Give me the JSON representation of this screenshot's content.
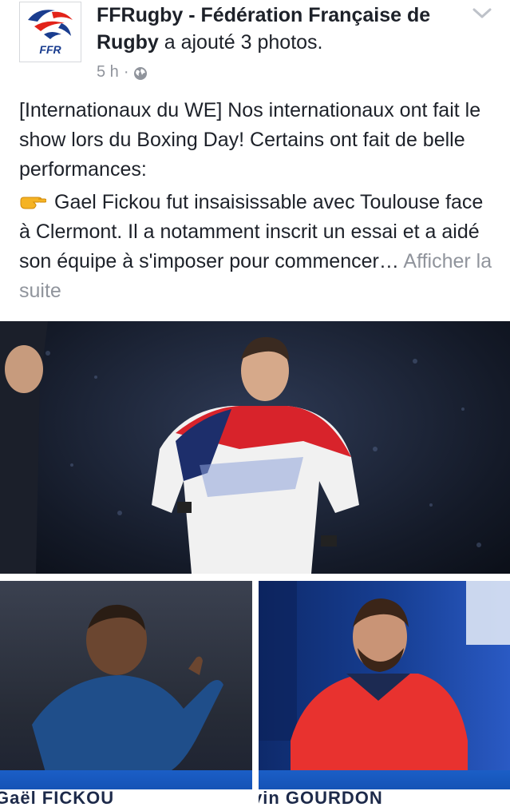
{
  "post": {
    "page_name": "FFRugby - Fédération Française de Rugby",
    "action_text": " a ajouté 3 photos.",
    "time": "5 h",
    "separator": "·",
    "logo_text": "FFR",
    "paragraph1": "[Internationaux du WE] Nos internationaux ont fait le show lors du Boxing Day! Certains ont fait de belle performances:",
    "paragraph2": "Gael Fickou fut insaisissable avec Toulouse face à Clermont. Il a notamment inscrit un essai et a aidé son équipe à s'imposer pour commencer…",
    "see_more": "Afficher la suite"
  },
  "photos": [
    {
      "caption": ""
    },
    {
      "caption": "Gaël FICKOU"
    },
    {
      "caption": "vin GOURDON"
    }
  ],
  "colors": {
    "text": "#1d2129",
    "secondary": "#90949c",
    "ffr_blue": "#1a3d8f",
    "ffr_red": "#e2231a"
  },
  "icons": [
    "ffr-logo",
    "globe-icon",
    "chevron-down-icon",
    "pointing-hand-icon"
  ]
}
